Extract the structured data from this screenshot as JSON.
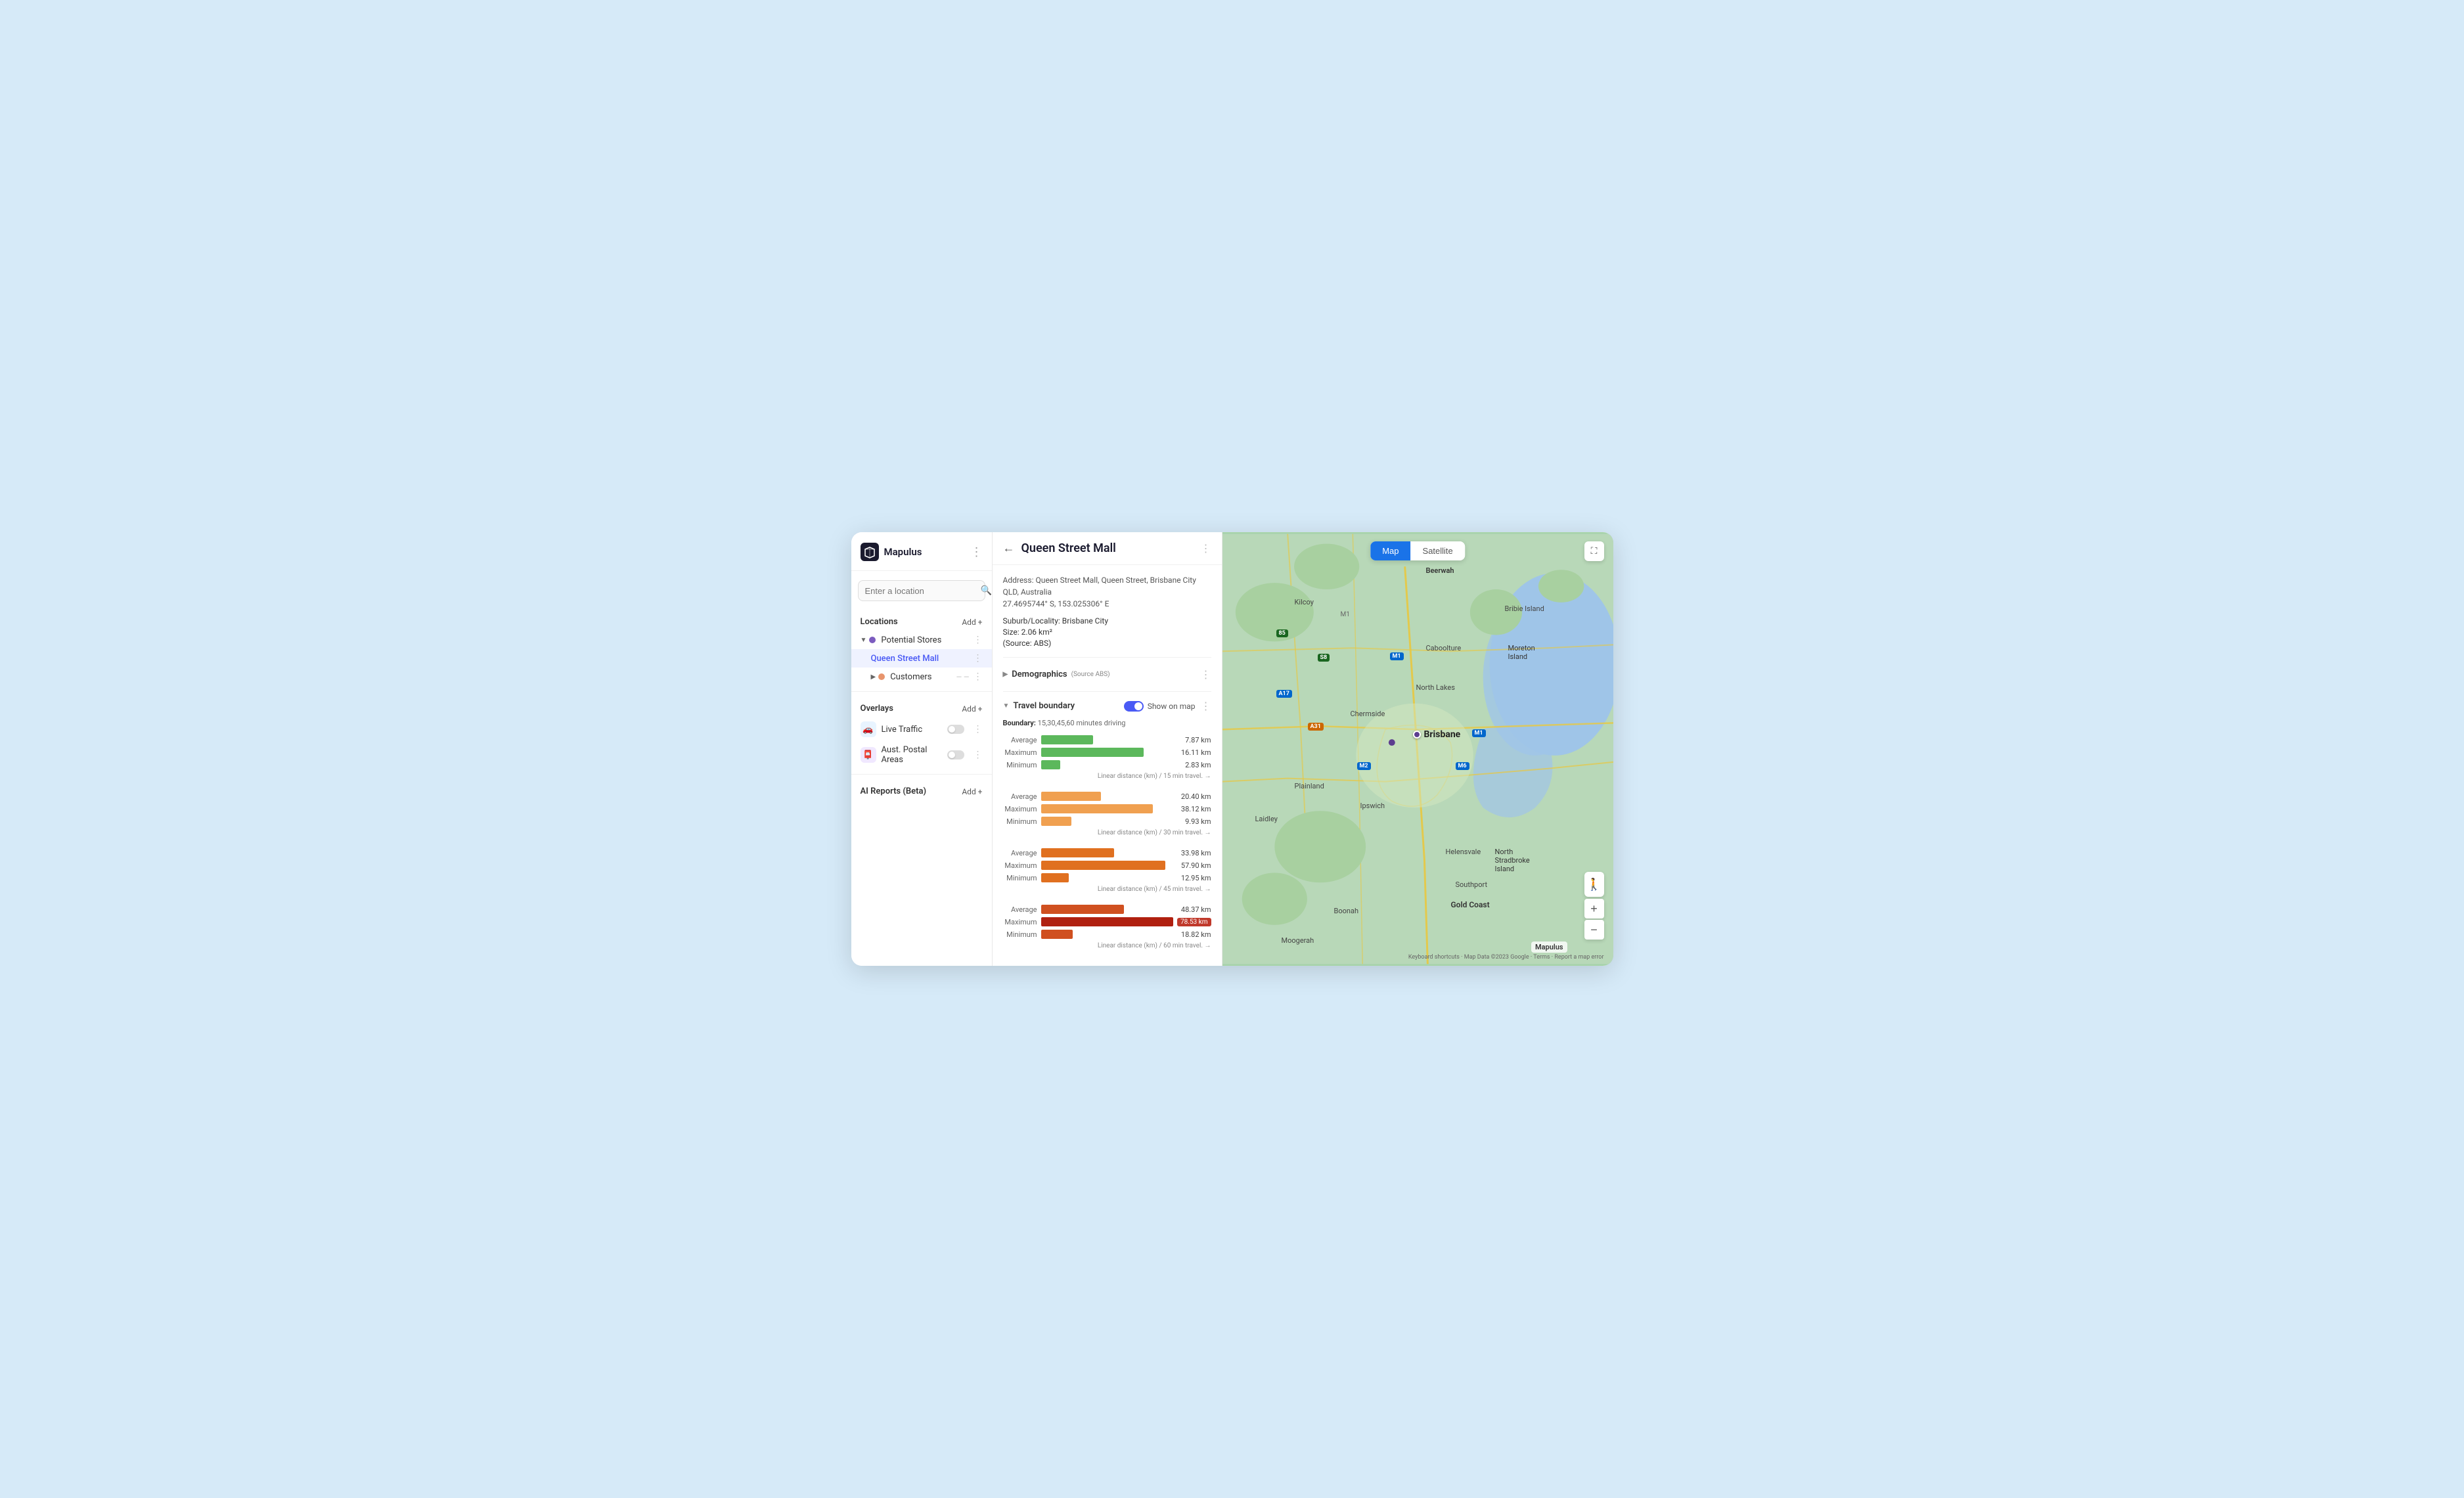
{
  "app": {
    "name": "Mapulus",
    "logo_unicode": "🗺"
  },
  "sidebar": {
    "search_placeholder": "Enter a location",
    "locations_label": "Locations",
    "add_label": "Add +",
    "potential_stores_label": "Potential Stores",
    "queen_street_mall_label": "Queen Street Mall",
    "customers_label": "Customers",
    "overlays_label": "Overlays",
    "live_traffic_label": "Live Traffic",
    "aust_postal_label": "Aust. Postal Areas",
    "ai_reports_label": "AI Reports (Beta)"
  },
  "detail": {
    "back_label": "←",
    "title": "Queen Street Mall",
    "address": "Address: Queen Street Mall, Queen Street, Brisbane City QLD, Australia",
    "coordinates": "27.4695744° S, 153.025306° E",
    "suburb_label": "Suburb/Locality:",
    "suburb_value": "Brisbane City",
    "size_label": "Size:",
    "size_value": "2.06 km²",
    "source_label": "(Source: ABS)",
    "demographics_label": "Demographics",
    "demographics_source": "Source ABS",
    "travel_boundary_label": "Travel boundary",
    "show_on_map_label": "Show on map",
    "boundary_desc_label": "Boundary:",
    "boundary_desc_value": "15,30,45,60 minutes driving",
    "charts": [
      {
        "group": "15min",
        "footer": "Linear distance (km) / 15 min travel. →",
        "rows": [
          {
            "label": "Average",
            "value": 7.87,
            "value_text": "7.87 km",
            "max_width": 100,
            "color": "green",
            "bar_pct": 38
          },
          {
            "label": "Maximum",
            "value": 16.11,
            "value_text": "16.11 km",
            "max_width": 100,
            "color": "green",
            "bar_pct": 77
          },
          {
            "label": "Minimum",
            "value": 2.83,
            "value_text": "2.83 km",
            "max_width": 100,
            "color": "green",
            "bar_pct": 14
          }
        ]
      },
      {
        "group": "30min",
        "footer": "Linear distance (km) / 30 min travel. →",
        "rows": [
          {
            "label": "Average",
            "value": 20.4,
            "value_text": "20.40 km",
            "max_width": 100,
            "color": "orange-light",
            "bar_pct": 45
          },
          {
            "label": "Maximum",
            "value": 38.12,
            "value_text": "38.12 km",
            "max_width": 100,
            "color": "orange-light",
            "bar_pct": 84
          },
          {
            "label": "Minimum",
            "value": 9.93,
            "value_text": "9.93 km",
            "max_width": 100,
            "color": "orange-light",
            "bar_pct": 22
          }
        ]
      },
      {
        "group": "45min",
        "footer": "Linear distance (km) / 45 min travel. →",
        "rows": [
          {
            "label": "Average",
            "value": 33.98,
            "value_text": "33.98 km",
            "max_width": 100,
            "color": "orange",
            "bar_pct": 55
          },
          {
            "label": "Maximum",
            "value": 57.9,
            "value_text": "57.90 km",
            "max_width": 100,
            "color": "orange",
            "bar_pct": 93
          },
          {
            "label": "Minimum",
            "value": 12.95,
            "value_text": "12.95 km",
            "max_width": 100,
            "color": "orange",
            "bar_pct": 21
          }
        ]
      },
      {
        "group": "60min",
        "footer": "Linear distance (km) / 60 min travel. →",
        "rows": [
          {
            "label": "Average",
            "value": 48.37,
            "value_text": "48.37 km",
            "max_width": 100,
            "color": "red-light",
            "bar_pct": 62
          },
          {
            "label": "Maximum",
            "value": 78.53,
            "value_text": "78.53 km",
            "max_width": 100,
            "color": "red",
            "bar_pct": 100,
            "highlight": true
          },
          {
            "label": "Minimum",
            "value": 18.82,
            "value_text": "18.82 km",
            "max_width": 100,
            "color": "red-light",
            "bar_pct": 24
          }
        ]
      }
    ]
  },
  "map": {
    "tab_map": "Map",
    "tab_satellite": "Satellite",
    "active_tab": "Map",
    "city_label": "Brisbane",
    "zoom_in": "+",
    "zoom_out": "−",
    "attribution": "Keyboard shortcuts · Map Data ©2023 Google · Terms · Report a map error",
    "watermark": "Mapulus"
  }
}
